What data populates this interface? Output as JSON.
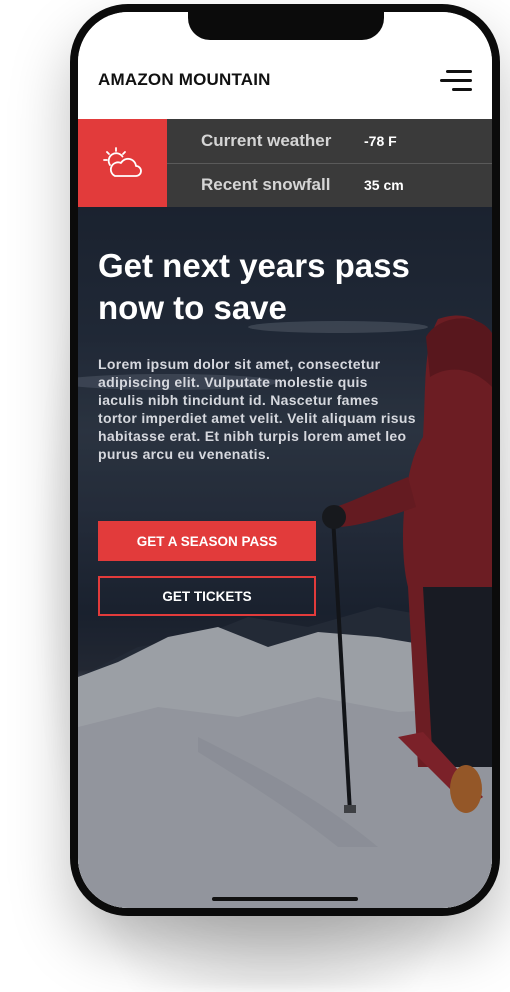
{
  "header": {
    "brand": "AMAZON MOUNTAIN",
    "menu_icon": "hamburger-menu-icon"
  },
  "weather": {
    "icon": "partly-cloudy-icon",
    "current_label": "Current weather",
    "current_value": "-78 F",
    "snowfall_label": "Recent snowfall",
    "snowfall_value": "35 cm"
  },
  "hero": {
    "title": "Get next years pass now to save",
    "body": "Lorem ipsum dolor sit amet, consectetur adipiscing elit. Vulputate molestie quis iaculis nibh tincidunt id. Nascetur fames tortor imperdiet amet velit. Velit aliquam risus habitasse erat. Et nibh turpis lorem amet leo purus arcu eu venenatis.",
    "primary_button": "GET A SEASON PASS",
    "secondary_button": "GET TICKETS"
  },
  "colors": {
    "accent": "#e23b3b",
    "weather_bar": "#3a3a3a"
  }
}
